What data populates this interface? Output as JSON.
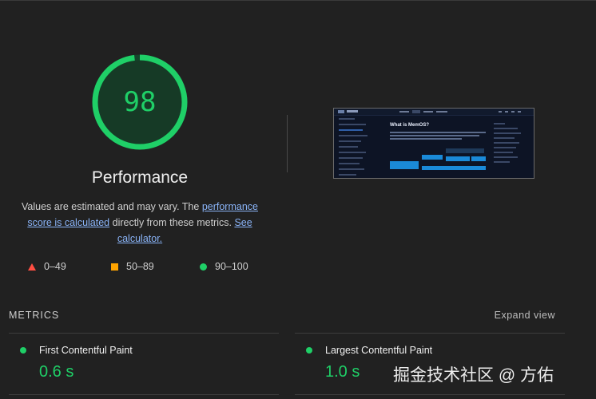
{
  "gauge": {
    "score": "98",
    "fraction": 0.98,
    "color": "#1fcf67",
    "track_color": "#14452b"
  },
  "performance": {
    "title": "Performance",
    "desc_before": "Values are estimated and may vary. The ",
    "desc_link1": "performance score is calculated",
    "desc_middle": " directly from these metrics. ",
    "desc_link2": "See calculator."
  },
  "legend": [
    {
      "icon": "red-triangle-icon",
      "range": "0–49",
      "color": "#ff4e42"
    },
    {
      "icon": "orange-square-icon",
      "range": "50–89",
      "color": "#ffa400"
    },
    {
      "icon": "green-circle-icon",
      "range": "90–100",
      "color": "#1fcf67"
    }
  ],
  "thumbnail": {
    "heading": "What is MemOS?"
  },
  "metrics": {
    "label": "METRICS",
    "expand": "Expand view",
    "items": [
      {
        "name": "First Contentful Paint",
        "value": "0.6 s",
        "status": "pass"
      },
      {
        "name": "Largest Contentful Paint",
        "value": "1.0 s",
        "status": "pass"
      }
    ]
  },
  "watermark": "掘金技术社区 @ 方佑"
}
